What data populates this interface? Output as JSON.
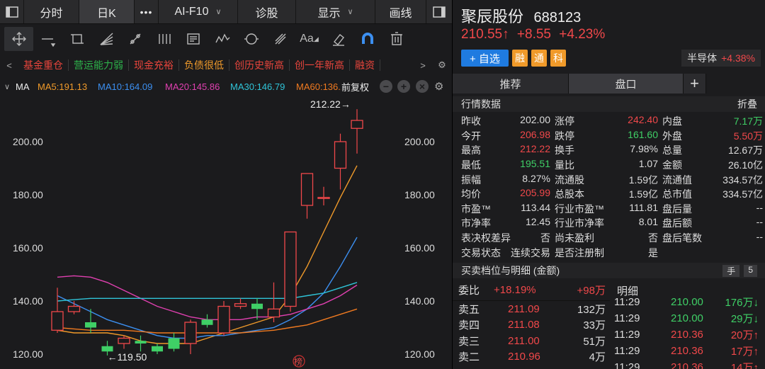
{
  "topbar": {
    "items": [
      "分时",
      "日K",
      "•••",
      "AI-F10",
      "诊股",
      "显示",
      "画线"
    ]
  },
  "tags": [
    "基金重仓",
    "营运能力弱",
    "现金充裕",
    "负债很低",
    "创历史新高",
    "创一年新高",
    "融资"
  ],
  "tag_colors": [
    "#e8453c",
    "#2db34b",
    "#e8453c",
    "#f09a2a",
    "#e8453c",
    "#e8453c",
    "#e8453c"
  ],
  "ma": {
    "label": "MA",
    "items": [
      {
        "text": "MA5:191.13",
        "color": "#f09a2a"
      },
      {
        "text": "MA10:164.09",
        "color": "#3c8ff0"
      },
      {
        "text": "MA20:145.86",
        "color": "#e040b0"
      },
      {
        "text": "MA30:146.79",
        "color": "#2fc4d8"
      },
      {
        "text": "MA60:136.1",
        "color": "#f07a20"
      }
    ],
    "adjust": "前复权"
  },
  "chart_data": {
    "type": "candlestick",
    "y_ticks": [
      "200.00",
      "180.00",
      "160.00",
      "140.00",
      "120.00"
    ],
    "ylim": [
      115,
      210
    ],
    "high_label": "212.22→",
    "low_label": "←119.50",
    "marker": "榜",
    "candles": [
      {
        "o": 129,
        "c": 136,
        "h": 145,
        "l": 128
      },
      {
        "o": 136,
        "c": 138,
        "h": 140,
        "l": 135
      },
      {
        "o": 132,
        "c": 130,
        "h": 137,
        "l": 128
      },
      {
        "o": 123,
        "c": 121,
        "h": 125,
        "l": 119.5
      },
      {
        "o": 124,
        "c": 126,
        "h": 127,
        "l": 122
      },
      {
        "o": 125,
        "c": 124,
        "h": 127,
        "l": 121
      },
      {
        "o": 123,
        "c": 121,
        "h": 124,
        "l": 120
      },
      {
        "o": 126,
        "c": 122,
        "h": 128,
        "l": 121
      },
      {
        "o": 124,
        "c": 132,
        "h": 133,
        "l": 120
      },
      {
        "o": 133,
        "c": 131,
        "h": 135,
        "l": 130
      },
      {
        "o": 128,
        "c": 138,
        "h": 140,
        "l": 127
      },
      {
        "o": 138,
        "c": 139,
        "h": 141,
        "l": 137
      },
      {
        "o": 139,
        "c": 137,
        "h": 141,
        "l": 133
      },
      {
        "o": 134,
        "c": 137,
        "h": 147,
        "l": 132
      },
      {
        "o": 138,
        "c": 166,
        "h": 166,
        "l": 136
      },
      {
        "o": 176,
        "c": 188,
        "h": 188,
        "l": 171
      },
      {
        "o": 179,
        "c": 179,
        "h": 183,
        "l": 176
      },
      {
        "o": 190,
        "c": 200,
        "h": 203,
        "l": 182
      },
      {
        "o": 205,
        "c": 208,
        "h": 212.22,
        "l": 195.51
      }
    ],
    "ma_lines": [
      {
        "color": "#f09a2a",
        "values": [
          129,
          128,
          128,
          128,
          127,
          125,
          124,
          124,
          124,
          126,
          128,
          130,
          132,
          134,
          142,
          153,
          166,
          179,
          191
        ]
      },
      {
        "color": "#3c8ff0",
        "values": [
          142,
          139,
          136,
          133,
          131,
          129,
          127,
          126,
          126,
          127,
          127,
          128,
          129,
          130,
          133,
          137,
          143,
          153,
          164
        ]
      },
      {
        "color": "#e040b0",
        "values": [
          149,
          149.5,
          149,
          147,
          144,
          141,
          138,
          136,
          134,
          133,
          133,
          133,
          134,
          134,
          135,
          137,
          139,
          142,
          146
        ]
      },
      {
        "color": "#2fc4d8",
        "values": [
          140,
          140.5,
          141,
          141,
          141,
          141,
          141,
          141,
          141,
          141,
          141,
          141,
          141,
          141,
          141,
          142,
          143,
          145,
          147
        ]
      },
      {
        "color": "#f07a20",
        "values": [
          130,
          129.5,
          129,
          129,
          129,
          128.5,
          128,
          128,
          128,
          128,
          128,
          128,
          128.5,
          129,
          130,
          131,
          133,
          135,
          137
        ]
      }
    ]
  },
  "stock": {
    "name": "聚辰股份",
    "code": "688123",
    "price": "210.55↑",
    "change": "+8.55",
    "pct": "+4.23%",
    "add_btn": "+ 自选",
    "badges": [
      "融",
      "通",
      "科"
    ],
    "sector_name": "半导体",
    "sector_pct": "+4.38%"
  },
  "tabs": {
    "rec": "推荐",
    "pankou": "盘口",
    "plus": "+"
  },
  "quote_title": "行情数据",
  "fold": "折叠",
  "quotes": [
    [
      {
        "k": "昨收",
        "v": "202.00",
        "c": "wht"
      },
      {
        "k": "涨停",
        "v": "242.40",
        "c": "red"
      },
      {
        "k": "内盘",
        "v": "7.17万",
        "c": "green"
      }
    ],
    [
      {
        "k": "今开",
        "v": "206.98",
        "c": "red"
      },
      {
        "k": "跌停",
        "v": "161.60",
        "c": "green"
      },
      {
        "k": "外盘",
        "v": "5.50万",
        "c": "red"
      }
    ],
    [
      {
        "k": "最高",
        "v": "212.22",
        "c": "red"
      },
      {
        "k": "换手",
        "v": "7.98%",
        "c": "wht"
      },
      {
        "k": "总量",
        "v": "12.67万",
        "c": "wht"
      }
    ],
    [
      {
        "k": "最低",
        "v": "195.51",
        "c": "green"
      },
      {
        "k": "量比",
        "v": "1.07",
        "c": "wht"
      },
      {
        "k": "金额",
        "v": "26.10亿",
        "c": "wht"
      }
    ],
    [
      {
        "k": "振幅",
        "v": "8.27%",
        "c": "wht"
      },
      {
        "k": "流通股",
        "v": "1.59亿",
        "c": "wht"
      },
      {
        "k": "流通值",
        "v": "334.57亿",
        "c": "wht"
      }
    ],
    [
      {
        "k": "均价",
        "v": "205.99",
        "c": "red"
      },
      {
        "k": "总股本",
        "v": "1.59亿",
        "c": "wht"
      },
      {
        "k": "总市值",
        "v": "334.57亿",
        "c": "wht"
      }
    ],
    [
      {
        "k": "市盈™",
        "v": "113.44",
        "c": "wht"
      },
      {
        "k": "行业市盈™",
        "v": "111.81",
        "c": "wht"
      },
      {
        "k": "盘后量",
        "v": "--",
        "c": "wht"
      }
    ],
    [
      {
        "k": "市净率",
        "v": "12.45",
        "c": "wht"
      },
      {
        "k": "行业市净率",
        "v": "8.01",
        "c": "wht"
      },
      {
        "k": "盘后额",
        "v": "--",
        "c": "wht"
      }
    ],
    [
      {
        "k": "表决权差异",
        "v": "否",
        "c": "wht"
      },
      {
        "k": "尚未盈利",
        "v": "否",
        "c": "wht"
      },
      {
        "k": "盘后笔数",
        "v": "--",
        "c": "wht"
      }
    ],
    [
      {
        "k": "交易状态",
        "v": "连续交易",
        "c": "wht"
      },
      {
        "k": "是否注册制",
        "v": "是",
        "c": "wht"
      },
      {
        "k": "",
        "v": "",
        "c": "wht"
      }
    ]
  ],
  "orderbook": {
    "title": "买卖档位与明细 (金额)",
    "hand": "手",
    "num": "5",
    "weibi_label": "委比",
    "weibi_pct": "+18.19%",
    "weibi_amt": "+98万",
    "detail_label": "明细",
    "asks": [
      {
        "label": "卖五",
        "price": "211.09",
        "vol": "132万"
      },
      {
        "label": "卖四",
        "price": "211.08",
        "vol": "33万"
      },
      {
        "label": "卖三",
        "price": "211.00",
        "vol": "51万"
      },
      {
        "label": "卖二",
        "price": "210.96",
        "vol": "4万"
      }
    ],
    "ticks": [
      {
        "time": "11:29",
        "price": "210.00",
        "vol": "176万↓",
        "c": "green"
      },
      {
        "time": "11:29",
        "price": "210.00",
        "vol": "29万↓",
        "c": "green"
      },
      {
        "time": "11:29",
        "price": "210.36",
        "vol": "20万↑",
        "c": "red"
      },
      {
        "time": "11:29",
        "price": "210.36",
        "vol": "17万↑",
        "c": "red"
      },
      {
        "time": "11:29",
        "price": "210.36",
        "vol": "14万↑",
        "c": "red"
      }
    ]
  }
}
